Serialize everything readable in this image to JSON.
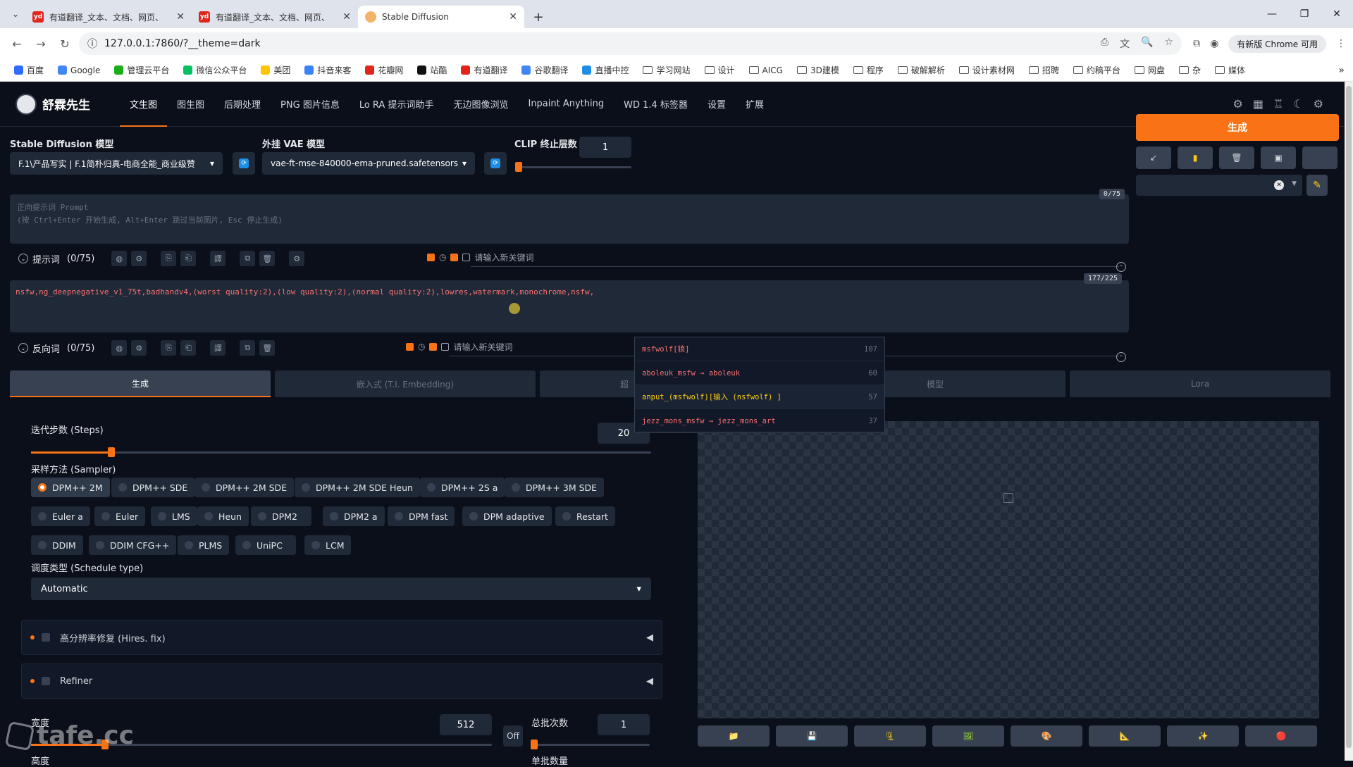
{
  "browser": {
    "tabs": [
      {
        "title": "有道翻译_文本、文档、网页、",
        "icon": "youdao-icon",
        "active": false
      },
      {
        "title": "有道翻译_文本、文档、网页、",
        "icon": "youdao-icon",
        "active": false
      },
      {
        "title": "Stable Diffusion",
        "icon": "sd-icon",
        "active": true
      }
    ],
    "url": "127.0.0.1:7860/?__theme=dark",
    "chrome_update_label": "有新版 Chrome 可用",
    "bookmarks": [
      "百度",
      "Google",
      "管理云平台",
      "微信公众平台",
      "美团",
      "抖音来客",
      "花瓣网",
      "站酷",
      "有道翻译",
      "谷歌翻译",
      "直播中控",
      "学习网站",
      "设计",
      "AICG",
      "3D建模",
      "程序",
      "破解解析",
      "设计素材网",
      "招聘",
      "约稿平台",
      "网盘",
      "杂",
      "媒体"
    ]
  },
  "app": {
    "brand": "舒霖先生",
    "nav_tabs": [
      "文生图",
      "图生图",
      "后期处理",
      "PNG 图片信息",
      "Lo RA 提示词助手",
      "无边图像浏览",
      "Inpaint Anything",
      "WD 1.4 标签器",
      "设置",
      "扩展"
    ],
    "sd_model_label": "Stable Diffusion 模型",
    "sd_model_value": "F.1\\产品写实 | F.1简朴归真-电商全能_商业级赞",
    "vae_label": "外挂 VAE 模型",
    "vae_value": "vae-ft-mse-840000-ema-pruned.safetensors",
    "clip_label": "CLIP 终止层数",
    "clip_value": "1",
    "clip_fraction": 0.0
  },
  "prompt": {
    "placeholder_line1": "正向提示词 Prompt",
    "placeholder_line2": "(按 Ctrl+Enter 开始生成, Alt+Enter 跳过当前图片, Esc 停止生成)",
    "counter": "0/75",
    "section_label": "提示词",
    "section_count": "(0/75)",
    "keyword_placeholder": "请输入新关键词"
  },
  "negative": {
    "text": "nsfw,ng_deepnegative_v1_75t,badhandv4,(worst quality:2),(low quality:2),(normal quality:2),lowres,watermark,monochrome,nsfw,",
    "counter": "177/225",
    "section_label": "反向词",
    "section_count": "(0/75)",
    "keyword_placeholder": "请输入新关键词"
  },
  "autocomplete": [
    {
      "text": "msfwolf[狼]",
      "count": "107"
    },
    {
      "text": "aboleuk_msfw → aboleuk",
      "count": "60"
    },
    {
      "text": "anput_(msfwolf)[输入 (nsfwolf) ]",
      "count": "57"
    },
    {
      "text": "jezz_mons_msfw → jezz_mons_art",
      "count": "37"
    }
  ],
  "right": {
    "generate_label": "生成",
    "small_buttons": [
      "↙",
      "▮",
      "🗑",
      "▣",
      ""
    ],
    "pencil": "✎"
  },
  "subtabs": [
    "生成",
    "嵌入式 (T.I. Embedding)",
    "超",
    "模型",
    "Lora"
  ],
  "params": {
    "steps_label": "迭代步数 (Steps)",
    "steps_value": "20",
    "steps_fraction": 0.13,
    "sampler_label": "采样方法 (Sampler)",
    "samplers_row1": [
      "DPM++ 2M",
      "DPM++ SDE",
      "DPM++ 2M SDE",
      "DPM++ 2M SDE Heun",
      "DPM++ 2S a",
      "DPM++ 3M SDE"
    ],
    "samplers_row2": [
      "Euler a",
      "Euler",
      "LMS",
      "Heun",
      "DPM2",
      "DPM2 a",
      "DPM fast",
      "DPM adaptive",
      "Restart"
    ],
    "samplers_row3": [
      "DDIM",
      "DDIM CFG++",
      "PLMS",
      "UniPC",
      "LCM"
    ],
    "selected_sampler": "DPM++ 2M",
    "schedule_label": "调度类型 (Schedule type)",
    "schedule_value": "Automatic",
    "hires_label": "高分辨率修复 (Hires. fix)",
    "refiner_label": "Refiner",
    "width_label": "宽度",
    "width_value": "512",
    "width_fraction": 0.16,
    "height_label": "高度",
    "off_label": "Off",
    "batch_count_label": "总批次数",
    "batch_count_value": "1",
    "batch_size_label": "单批数量"
  },
  "output_buttons": [
    "📁",
    "💾",
    "🗜",
    "🖼",
    "🎨",
    "📐",
    "✨",
    "🔴"
  ],
  "watermark": "tafe.cc"
}
